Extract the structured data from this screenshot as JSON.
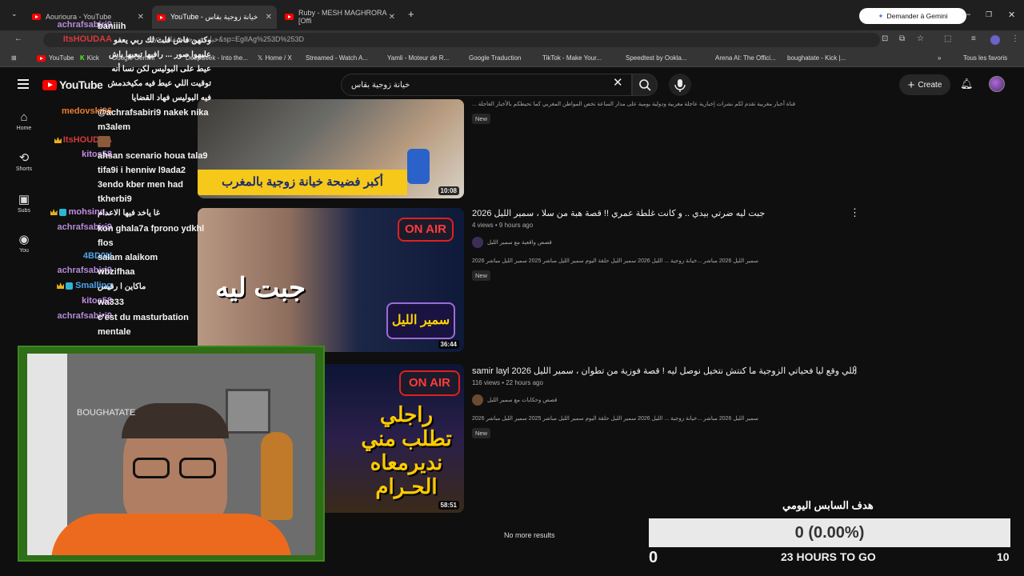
{
  "tabs": [
    {
      "title": "Aourioura - YouTube"
    },
    {
      "title": "YouTube - خيانة زوجية بقاس"
    },
    {
      "title": "Ruby - MESH MAGHRORA [Offi"
    }
  ],
  "gemini_label": "Demander à Gemini",
  "address": "ery=خيانة+زوجية+بقاس&sp=EgIIAg%253D%253D",
  "bookmarks": [
    "YouTube",
    "Kick",
    "Google Gemini",
    "DeepSeek - Into the...",
    "Home / X",
    "Streamed - Watch A...",
    "Yamli - Moteur de R...",
    "Google Traduction",
    "TikTok - Make Your...",
    "Speedtest by Ookla...",
    "Arena AI: The Offici...",
    "boughatate - Kick |...",
    "Tous les favoris"
  ],
  "yt": {
    "logo": "YouTube",
    "search_query": "خيانة زوجية بقاس",
    "create_label": "Create",
    "nav": [
      "Home",
      "Shorts",
      "Subscriptions",
      "You"
    ]
  },
  "chat": [
    {
      "user": "achrafsabiri9",
      "text": "baniiih",
      "color": "#b48bd8"
    },
    {
      "user": "ItsHOUDAA",
      "text": "وكنهن فاش قلت لك ربي يعفو",
      "color": "#d63a3a"
    },
    {
      "user": "",
      "text": "عليهوا صور ... رافيها تبعيها باش",
      "color": "#b48bd8"
    },
    {
      "user": "",
      "text": "عيط على البوليس لكن نسا أنه",
      "color": "#b48bd8"
    },
    {
      "user": "",
      "text": "توقيت اللي عيط فيه مكيخدمش فيه البوليس فهاد القضايا",
      "color": "#b48bd8"
    },
    {
      "user": "medovski96",
      "text": "@achrafsabiri9 nakek nika m3alem",
      "color": "#e87c2f"
    },
    {
      "user": "ItsHOUDAA",
      "text": "",
      "color": "#d63a3a"
    },
    {
      "user": "kitos58",
      "text": "ahsan scenario houa tala9 tifa9i i henniw l9ada2 3endo kber men had tkherbi9",
      "color": "#c38de5"
    },
    {
      "user": "mohsine...",
      "text": "غا ياخد فيها الاعدام",
      "color": "#c38de5"
    },
    {
      "user": "achrafsabiri9",
      "text": "kon ghala7a fprono ydkhl flos",
      "color": "#b48bd8"
    },
    {
      "user": "4BD0U",
      "text": "salam alaikom",
      "color": "#4ea2ea"
    },
    {
      "user": "achrafsabiri9",
      "text": "wbzifhaa",
      "color": "#b48bd8"
    },
    {
      "user": "Smalling",
      "text": "ماكاين ا رقيس",
      "color": "#4ea2ea"
    },
    {
      "user": "kitos58",
      "text": "wa333",
      "color": "#c38de5"
    },
    {
      "user": "achrafsabiri9",
      "text": "c'est du masturbation mentale",
      "color": "#b48bd8"
    }
  ],
  "results": [
    {
      "top_desc": "قناة أخبار مغربية تقدم لكم نشرات إخبارية عاجلة مغربية ودولية يومية على مدار الساعة تخص المواطن المغربي كما تحيطكم بالأخبار العاجلة ...",
      "new_label": "New",
      "duration": "10:08",
      "thumb_caption": "أكبر فضيحة خيانة زوجية بالمغرب"
    },
    {
      "title": "جبت ليه ضرتي بيدي .. و كانت غلطة عمري !! قصة هبة من سلا ، سمير الليل 2026",
      "meta": "4 views • 9 hours ago",
      "channel": "قصص واقعية مع سمير الليل",
      "desc": "2026 سمير الليل 2026 مباشر ...خيانة زوجية ... الليل 2026 سمير الليل حلقة اليوم سمير الليل مباشر 2025 سمير الليل مباشر",
      "new_label": "New",
      "duration": "36:44",
      "thumb_text": "جبت ليه",
      "onair": "ON AIR",
      "host": "سمير الليل"
    },
    {
      "title": "اللي وقع ليا فحياتي الزوجية ما كنتش نتخيل نوصل ليه ! قصة فوزية من تطوان ، سمير الليل 2026 samir layl",
      "meta": "116 views • 22 hours ago",
      "channel": "قصص وحكايات مع سمير الليل",
      "desc": "2026 سمير الليل 2026 مباشر ...خيانة زوجية ... الليل 2026 سمير الليل حلقة اليوم سمير الليل مباشر 2025 سمير الليل مباشر",
      "new_label": "New",
      "duration": "58:51",
      "thumb_text": "راجلي تطلب مني نديرمعاه الحـرام",
      "onair": "ON AIR"
    }
  ],
  "no_more": "No more results",
  "webcam_label": "BOUGHATATE",
  "goal": {
    "title": "هدف السابس اليومي",
    "value_text": "0 (0.00%)",
    "progress_fraction": 0,
    "min": "0",
    "time_left": "23 HOURS TO GO",
    "max": "10"
  }
}
